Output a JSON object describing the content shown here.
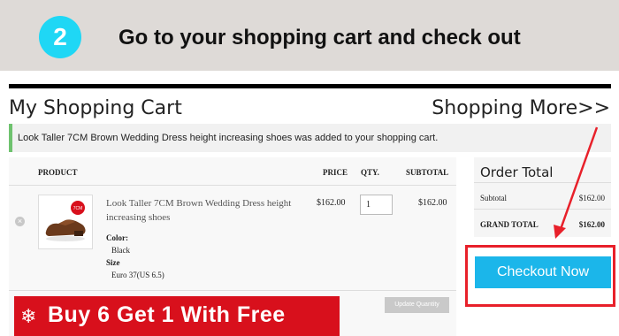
{
  "banner": {
    "step_number": "2",
    "instruction": "Go to your shopping cart and check out"
  },
  "header": {
    "title": "My Shopping Cart",
    "shopping_more_link": "Shopping More>>"
  },
  "notice": "Look Taller 7CM Brown Wedding Dress height increasing shoes was added to your shopping cart.",
  "cart_table": {
    "columns": [
      "PRODUCT",
      "PRICE",
      "QTY.",
      "SUBTOTAL"
    ],
    "items": [
      {
        "name": "Look Taller 7CM Brown Wedding Dress height increasing shoes",
        "options": [
          {
            "label": "Color",
            "value": "Black"
          },
          {
            "label": "Size",
            "value": "Euro 37(US 6.5)"
          }
        ],
        "price": "$162.00",
        "quantity": "1",
        "subtotal": "$162.00"
      }
    ],
    "update_quantity_label": "Update Quantity"
  },
  "promo_banner": "Buy 6 Get 1 With Free",
  "order_total": {
    "title": "Order Total",
    "subtotal_label": "Subtotal",
    "subtotal_value": "$162.00",
    "grand_total_label": "GRAND TOTAL",
    "grand_total_value": "$162.00"
  },
  "checkout_button": "Checkout Now",
  "colors": {
    "banner_bg": "#dedad7",
    "step_circle": "#1fd7f5",
    "checkout_button": "#1bb6ea",
    "highlight_red": "#e8202a",
    "promo_red": "#d8101c",
    "notice_accent": "#6ec26e"
  },
  "icons": {
    "remove": "remove-circle-icon",
    "annotation": "red-arrow-icon"
  }
}
